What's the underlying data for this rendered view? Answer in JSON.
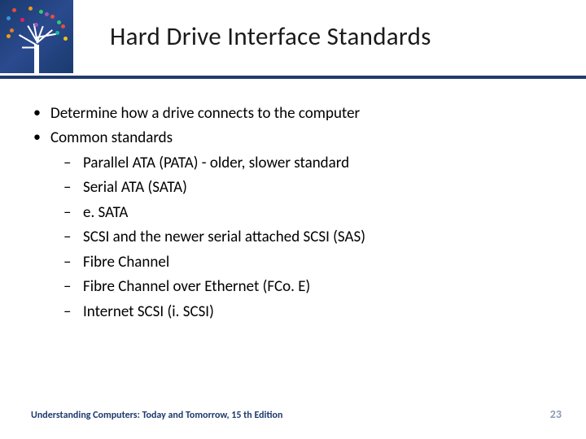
{
  "title": "Hard Drive Interface Standards",
  "bullets": {
    "l1_0": "Determine how a drive connects to the computer",
    "l1_1": "Common standards",
    "l2_0": "Parallel ATA (PATA) - older, slower standard",
    "l2_1": "Serial ATA (SATA)",
    "l2_2": "e. SATA",
    "l2_3": "SCSI and the newer serial attached SCSI (SAS)",
    "l2_4": "Fibre Channel",
    "l2_5": "Fibre Channel over Ethernet (FCo. E)",
    "l2_6": "Internet SCSI (i. SCSI)"
  },
  "footer": "Understanding Computers: Today and Tomorrow, 15 th Edition",
  "page_number": "23"
}
